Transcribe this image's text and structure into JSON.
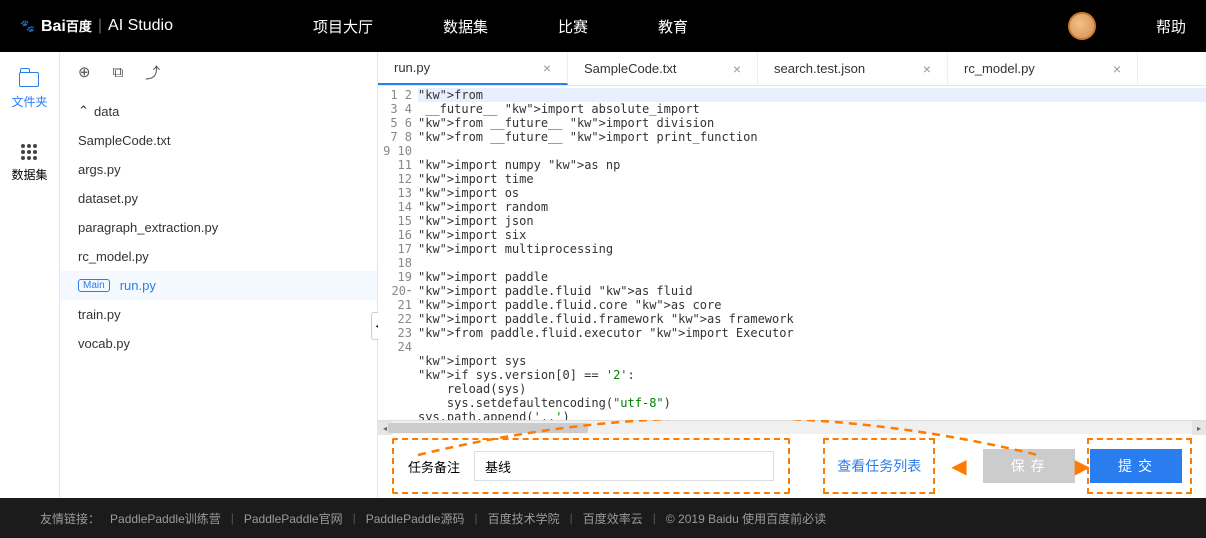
{
  "nav": {
    "logo_baidu": "Bai",
    "logo_du": "百度",
    "logo_studio": "AI Studio",
    "items": [
      "项目大厅",
      "数据集",
      "比赛",
      "教育"
    ],
    "help": "帮助"
  },
  "rail": {
    "files": "文件夹",
    "dataset": "数据集"
  },
  "sidebar": {
    "tree_root": "data",
    "files": [
      "SampleCode.txt",
      "args.py",
      "dataset.py",
      "paragraph_extraction.py",
      "rc_model.py",
      "run.py",
      "train.py",
      "vocab.py"
    ],
    "main_badge": "Main",
    "active_file": "run.py"
  },
  "tabs": [
    {
      "label": "run.py",
      "active": true
    },
    {
      "label": "SampleCode.txt",
      "active": false
    },
    {
      "label": "search.test.json",
      "active": false
    },
    {
      "label": "rc_model.py",
      "active": false
    }
  ],
  "code_lines": [
    "from __future__ import absolute_import",
    "from __future__ import division",
    "from __future__ import print_function",
    "",
    "import numpy as np",
    "import time",
    "import os",
    "import random",
    "import json",
    "import six",
    "import multiprocessing",
    "",
    "import paddle",
    "import paddle.fluid as fluid",
    "import paddle.fluid.core as core",
    "import paddle.fluid.framework as framework",
    "from paddle.fluid.executor import Executor",
    "",
    "import sys",
    "if sys.version[0] == '2':",
    "    reload(sys)",
    "    sys.setdefaultencoding(\"utf-8\")",
    "sys.path.append('..')",
    ""
  ],
  "bottom": {
    "note_label": "任务备注",
    "note_value": "基线",
    "view_tasks": "查看任务列表",
    "save": "保存",
    "submit": "提交"
  },
  "footer": {
    "label": "友情链接：",
    "links": [
      "PaddlePaddle训练营",
      "PaddlePaddle官网",
      "PaddlePaddle源码",
      "百度技术学院",
      "百度效率云"
    ],
    "copyright": "© 2019 Baidu 使用百度前必读"
  }
}
